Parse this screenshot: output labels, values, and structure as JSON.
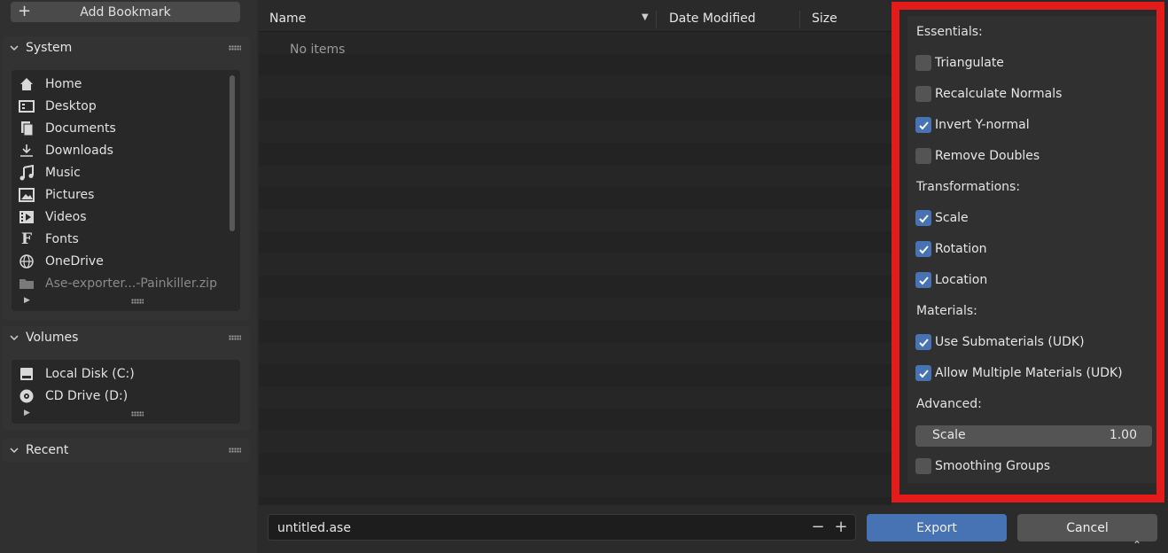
{
  "sidebar": {
    "add_bookmark": "Add Bookmark",
    "system": {
      "title": "System",
      "items": [
        {
          "label": "Home",
          "icon": "home-icon"
        },
        {
          "label": "Desktop",
          "icon": "desktop-icon"
        },
        {
          "label": "Documents",
          "icon": "documents-icon"
        },
        {
          "label": "Downloads",
          "icon": "download-icon"
        },
        {
          "label": "Music",
          "icon": "music-icon"
        },
        {
          "label": "Pictures",
          "icon": "pictures-icon"
        },
        {
          "label": "Videos",
          "icon": "videos-icon"
        },
        {
          "label": "Fonts",
          "icon": "fonts-icon"
        },
        {
          "label": "OneDrive",
          "icon": "globe-icon"
        },
        {
          "label": "Ase-exporter...-Painkiller.zip",
          "icon": "folder-icon"
        }
      ]
    },
    "volumes": {
      "title": "Volumes",
      "items": [
        {
          "label": "Local Disk (C:)",
          "icon": "disk-icon"
        },
        {
          "label": "CD Drive (D:)",
          "icon": "cd-icon"
        }
      ]
    },
    "recent": {
      "title": "Recent"
    }
  },
  "filelist": {
    "columns": {
      "name": "Name",
      "date": "Date Modified",
      "size": "Size"
    },
    "empty_text": "No items"
  },
  "options": {
    "essentials": "Essentials:",
    "triangulate": "Triangulate",
    "recalc_normals": "Recalculate Normals",
    "invert_y": "Invert Y-normal",
    "remove_doubles": "Remove Doubles",
    "transformations": "Transformations:",
    "scale": "Scale",
    "rotation": "Rotation",
    "location": "Location",
    "materials": "Materials:",
    "use_submaterials": "Use Submaterials (UDK)",
    "allow_multiple": "Allow Multiple Materials (UDK)",
    "advanced": "Advanced:",
    "scale_field_label": "Scale",
    "scale_field_value": "1.00",
    "smoothing_groups": "Smoothing Groups",
    "checked": {
      "triangulate": false,
      "recalc_normals": false,
      "invert_y": true,
      "remove_doubles": false,
      "scale": true,
      "rotation": true,
      "location": true,
      "use_submaterials": true,
      "allow_multiple": true,
      "smoothing_groups": false
    }
  },
  "bottom": {
    "filename": "untitled.ase",
    "minus": "−",
    "plus": "+",
    "export": "Export",
    "cancel": "Cancel"
  },
  "colors": {
    "accent": "#4772b3",
    "highlight_frame": "#e31b1b"
  }
}
